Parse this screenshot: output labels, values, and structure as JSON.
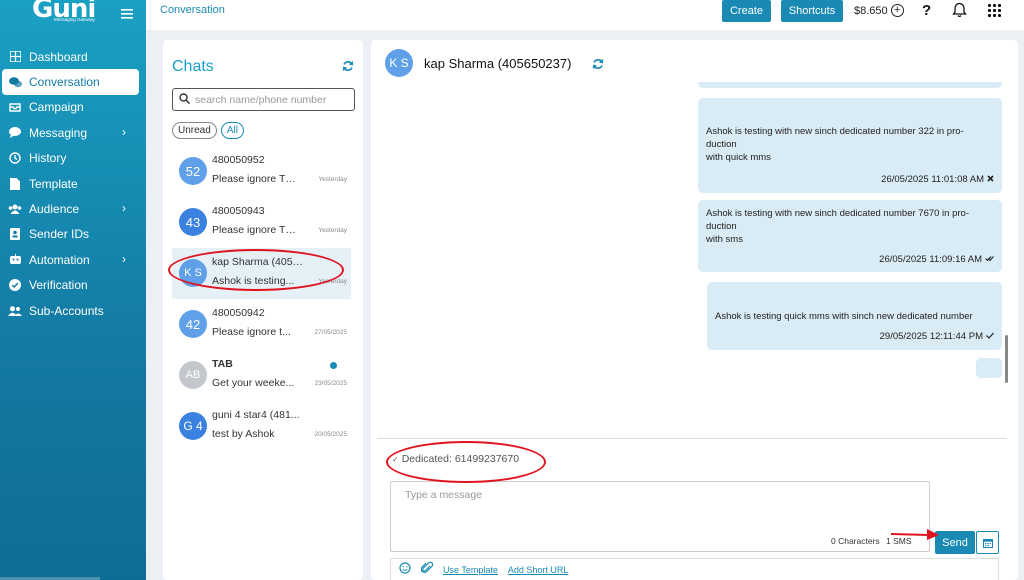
{
  "brand": {
    "name": "Guni",
    "tagline": "Messaging Gateway"
  },
  "sidebar": {
    "items": [
      {
        "label": "Dashboard",
        "icon": "dashboard-icon",
        "has_submenu": false,
        "active": false
      },
      {
        "label": "Conversation",
        "icon": "conversation-icon",
        "has_submenu": false,
        "active": true
      },
      {
        "label": "Campaign",
        "icon": "campaign-icon",
        "has_submenu": false,
        "active": false
      },
      {
        "label": "Messaging",
        "icon": "messaging-icon",
        "has_submenu": true,
        "active": false
      },
      {
        "label": "History",
        "icon": "history-icon",
        "has_submenu": false,
        "active": false
      },
      {
        "label": "Template",
        "icon": "template-icon",
        "has_submenu": false,
        "active": false
      },
      {
        "label": "Audience",
        "icon": "audience-icon",
        "has_submenu": true,
        "active": false
      },
      {
        "label": "Sender IDs",
        "icon": "sender-ids-icon",
        "has_submenu": false,
        "active": false
      },
      {
        "label": "Automation",
        "icon": "automation-icon",
        "has_submenu": true,
        "active": false
      },
      {
        "label": "Verification",
        "icon": "verification-icon",
        "has_submenu": false,
        "active": false
      },
      {
        "label": "Sub-Accounts",
        "icon": "sub-accounts-icon",
        "has_submenu": false,
        "active": false
      }
    ]
  },
  "header": {
    "breadcrumb": "Conversation",
    "create_label": "Create",
    "shortcuts_label": "Shortcuts",
    "balance": "$8.650",
    "help_label": "?"
  },
  "chats": {
    "title": "Chats",
    "search_placeholder": "search name/phone number",
    "filters": [
      "Unread",
      "All"
    ],
    "active_filter": "All",
    "items": [
      {
        "initials": "52",
        "name": "480050952",
        "preview": "Please ignore Th...",
        "date": "Yesterday",
        "avatar_color": "#5fa0e8",
        "unread": false
      },
      {
        "initials": "43",
        "name": "480050943",
        "preview": "Please ignore Th...",
        "date": "Yesterday",
        "avatar_color": "#3b82e0",
        "unread": false
      },
      {
        "initials": "K S",
        "name": "kap Sharma (40565...",
        "preview": "Ashok is testing...",
        "date": "Yesterday",
        "avatar_color": "#5fa0e8",
        "unread": false,
        "selected": true
      },
      {
        "initials": "42",
        "name": "480050942",
        "preview": "Please ignore t...",
        "date": "27/05/2025",
        "avatar_color": "#5fa0e8",
        "unread": false
      },
      {
        "initials": "AB",
        "name": "TAB",
        "preview": "Get your weeke...",
        "date": "23/05/2025",
        "avatar_color": "#c4c8cc",
        "unread": true
      },
      {
        "initials": "G 4",
        "name": "guni 4 star4 (481...",
        "preview": "test by Ashok",
        "date": "20/05/2025",
        "avatar_color": "#3b82e0",
        "unread": false
      }
    ]
  },
  "conversation": {
    "contact_initials": "K S",
    "contact_name": "kap Sharma (40565",
    "contact_name_suffix": "0237)",
    "messages": [
      {
        "lines": [
          "Ashok is testing with new sinch dedicated number 322  in pro-",
          "duction",
          "with quick mms"
        ],
        "timestamp": "26/05/2025 11:01:08 AM",
        "status_icon": "failed-x-icon"
      },
      {
        "lines": [
          "Ashok is testing with new sinch dedicated number 7670 in pro-",
          "duction",
          "with sms"
        ],
        "timestamp": "26/05/2025 11:09:16 AM",
        "status_icon": "delivered-double-check-icon"
      },
      {
        "lines": [
          "Ashok is testing quick mms with sinch new dedicated number"
        ],
        "timestamp": "29/05/2025 12:11:44 PM",
        "status_icon": "sent-check-icon"
      }
    ],
    "dedicated_label": "Dedicated: 61499237670",
    "message_placeholder": "Type a message",
    "char_count": "0 Characters",
    "sms_count": "1 SMS",
    "send_label": "Send",
    "use_template_label": "Use Template",
    "add_short_url_label": "Add Short URL"
  },
  "colors": {
    "accent": "#1a8ab5",
    "bubble": "#d9ebf4",
    "annotation": "#e0141e"
  }
}
